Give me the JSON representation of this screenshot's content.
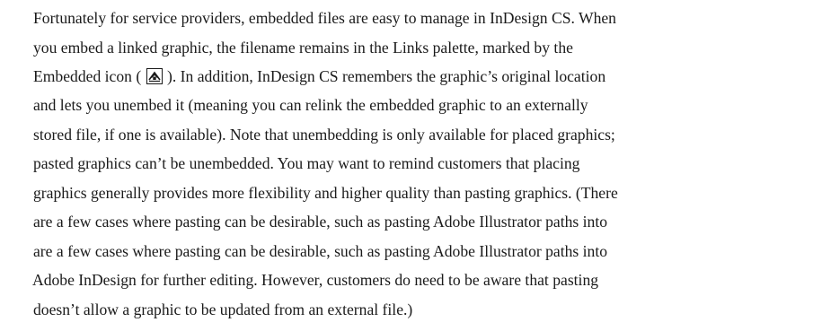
{
  "body": {
    "line1": "Fortunately for service providers, embedded files are easy to manage in InDesign CS. When",
    "line2": "you embed a linked graphic, the filename remains in the Links palette, marked by the",
    "line3_before_icon": "Embedded icon (",
    "line3_after_icon": "). In addition, InDesign CS remembers the graphic’s original location",
    "line4": "and lets you unembed it (meaning you can relink the embedded graphic to an externally",
    "line5": "stored file, if one is available). Note that unembedding is only available for placed graphics;",
    "line6": "pasted graphics can’t be unembedded. You may want to remind customers that placing",
    "line7": "graphics generally provides more flexibility and higher quality than pasting graphics. (There",
    "line8": "are a few cases where pasting can be desirable, such as pasting Adobe Illustrator paths into",
    "line9": "Adobe InDesign for further editing. However, customers do need to be aware that pasting",
    "line10": "doesn’t allow a graphic to be updated from an external file.)"
  },
  "icons": {
    "embedded": "embedded-icon"
  }
}
